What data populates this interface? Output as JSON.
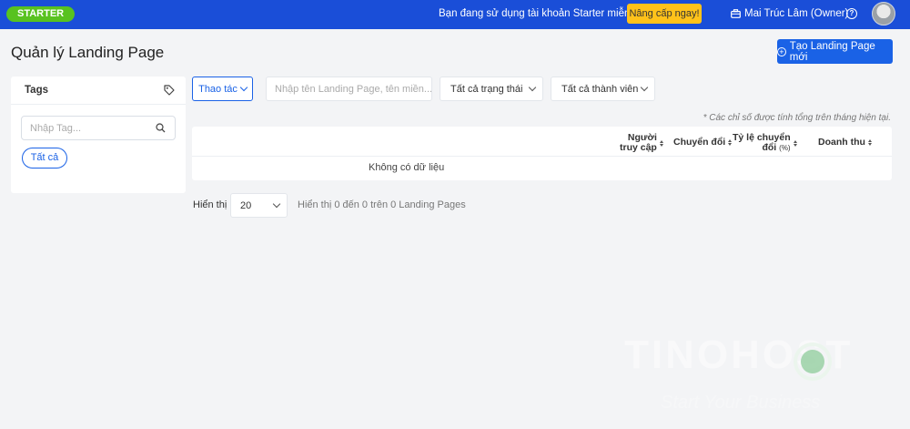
{
  "topbar": {
    "plan_badge": "STARTER",
    "message": "Bạn đang sử dụng tài khoản Starter miễn phí",
    "upgrade_label": "Nâng cấp ngay!",
    "user_name": "Mai Trúc Lâm (Owner)",
    "help_symbol": "?"
  },
  "header": {
    "title": "Quản lý Landing Page",
    "create_label": "Tạo Landing Page mới"
  },
  "tags": {
    "title": "Tags",
    "search_placeholder": "Nhập Tag...",
    "chip_all": "Tất cả"
  },
  "filters": {
    "action_label": "Thao tác",
    "search_placeholder": "Nhập tên Landing Page, tên miền...",
    "status_selected": "Tất cả trạng thái",
    "member_selected": "Tất cả thành viên"
  },
  "note": "* Các chỉ số được tính tổng trên tháng hiện tại.",
  "table": {
    "columns": {
      "visitors_line1": "Người",
      "visitors_line2": "truy cập",
      "conversions": "Chuyển đổi",
      "rate_line1": "Tỷ lệ chuyển",
      "rate_line2": "đổi",
      "rate_unit": "(%)",
      "revenue": "Doanh thu"
    },
    "empty_text": "Không có dữ liệu"
  },
  "pagination": {
    "show_label": "Hiển thị",
    "page_size": "20",
    "info": "Hiển thị 0 đến 0 trên 0 Landing Pages"
  },
  "watermark": {
    "brand": "TINOHOST",
    "slogan": "Start Your Business"
  },
  "colors": {
    "topbar": "#1a4ed8",
    "primary": "#1a62e6",
    "plan_badge": "#58c21f",
    "upgrade": "#ffc21a"
  }
}
